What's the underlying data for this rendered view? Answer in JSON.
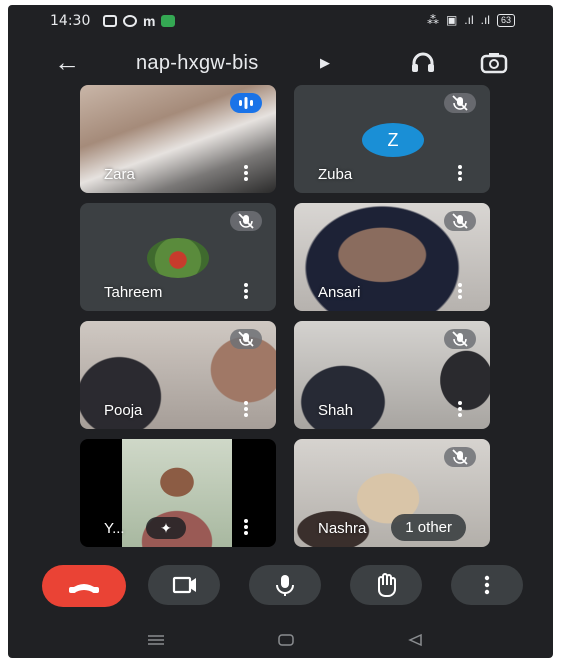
{
  "status_bar": {
    "time": "14:30",
    "battery": "63"
  },
  "header": {
    "meeting_code": "nap-hxgw-bis"
  },
  "participants": [
    {
      "name": "Zara",
      "state": "speaking"
    },
    {
      "name": "Zuba",
      "state": "muted",
      "initial": "Z"
    },
    {
      "name": "Tahreem",
      "state": "muted"
    },
    {
      "name": "Ansari",
      "state": "muted"
    },
    {
      "name": "Pooja",
      "state": "muted"
    },
    {
      "name": "Shah",
      "state": "muted"
    },
    {
      "name": "Y...",
      "state": "video"
    },
    {
      "name": "Nashra",
      "state": "muted",
      "extra": "1 other"
    }
  ],
  "controls": [
    "end-call",
    "camera",
    "microphone",
    "raise-hand",
    "more-options"
  ],
  "colors": {
    "background": "#202124",
    "tile": "#3c4043",
    "end_call": "#ea4335",
    "accent": "#1a73e8"
  }
}
